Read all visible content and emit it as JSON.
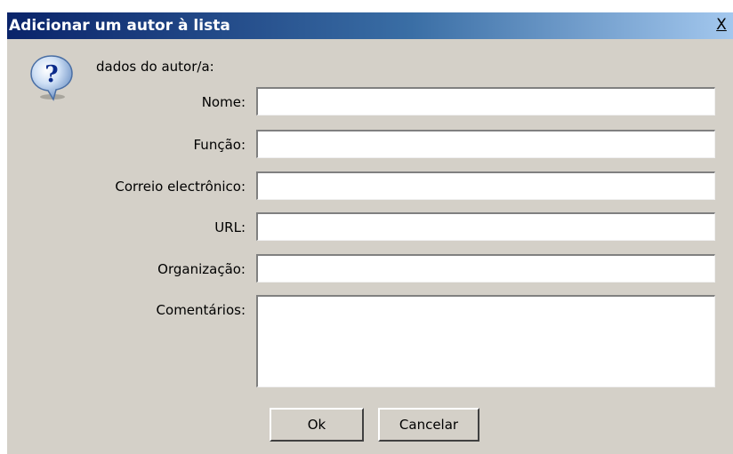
{
  "window": {
    "title": "Adicionar um autor à lista",
    "close_label": "X"
  },
  "form": {
    "heading": "dados do autor/a:",
    "fields": [
      {
        "label": "Nome:",
        "value": ""
      },
      {
        "label": "Função:",
        "value": ""
      },
      {
        "label": "Correio electrônico:",
        "value": ""
      },
      {
        "label": "URL:",
        "value": ""
      },
      {
        "label": "Organização:",
        "value": ""
      },
      {
        "label": "Comentários:",
        "value": ""
      }
    ]
  },
  "buttons": {
    "ok": "Ok",
    "cancel": "Cancelar"
  },
  "icons": {
    "dialog_icon": "question-icon",
    "icon_glyph": "?"
  },
  "colors": {
    "titlebar_start": "#0a246a",
    "titlebar_end": "#a6caf0",
    "dialog_background": "#d4d0c8"
  }
}
